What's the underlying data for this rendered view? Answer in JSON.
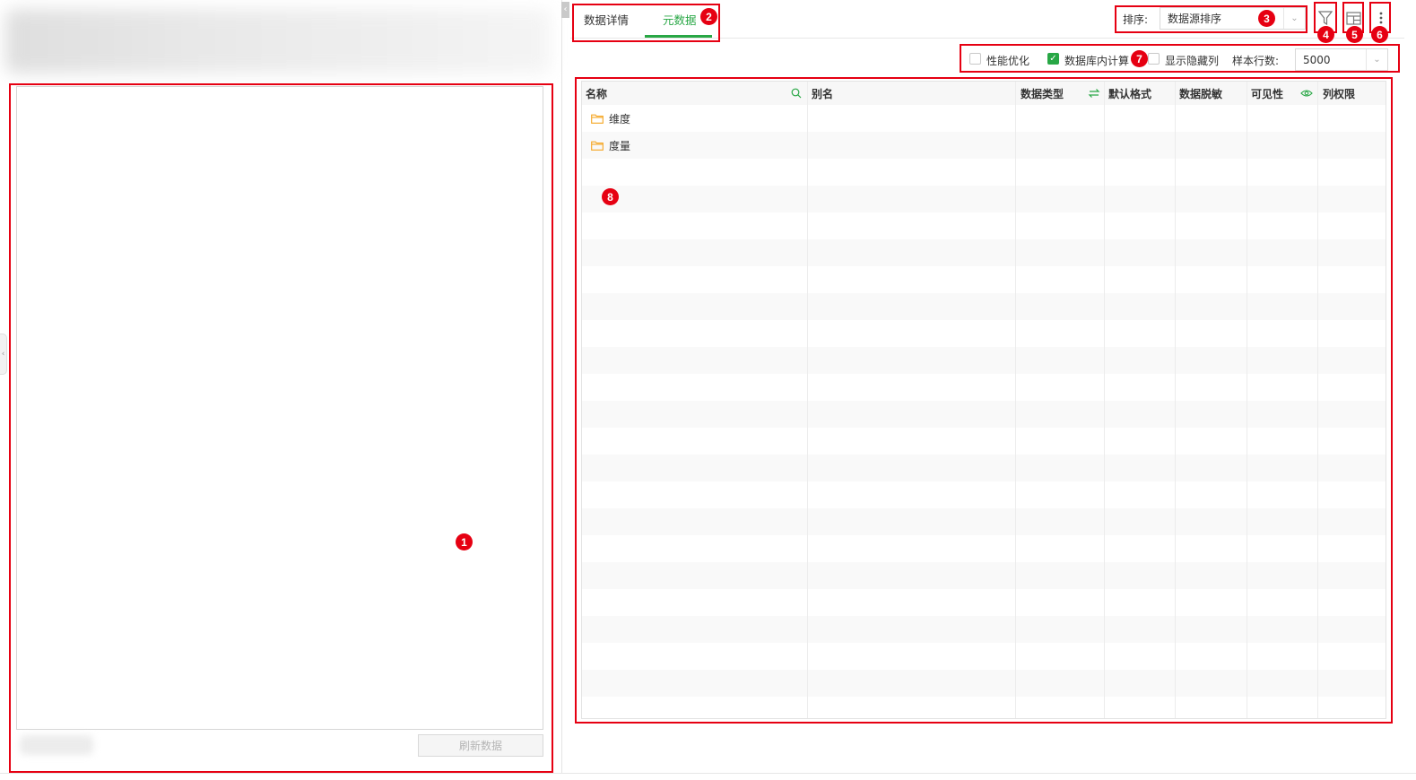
{
  "tabs": [
    {
      "label": "数据详情",
      "active": false
    },
    {
      "label": "元数据",
      "active": true
    }
  ],
  "sort": {
    "label": "排序:",
    "value": "数据源排序"
  },
  "options": {
    "performance": {
      "label": "性能优化",
      "checked": false
    },
    "db_compute": {
      "label": "数据库内计算",
      "checked": true
    },
    "show_hidden": {
      "label": "显示隐藏列",
      "checked": false
    },
    "sample_rows_label": "样本行数:",
    "sample_rows_value": "5000"
  },
  "table": {
    "headers": {
      "name": "名称",
      "alias": "别名",
      "data_type": "数据类型",
      "default_format": "默认格式",
      "masking": "数据脱敏",
      "visibility": "可见性",
      "column_permission": "列权限"
    },
    "rows": [
      {
        "name": "维度",
        "icon": "folder-icon"
      },
      {
        "name": "度量",
        "icon": "folder-icon"
      }
    ]
  },
  "left_panel": {
    "refresh_label": "刷新数据"
  },
  "annotations": [
    "1",
    "2",
    "3",
    "4",
    "5",
    "6",
    "7",
    "8"
  ],
  "colors": {
    "accent": "#28a745",
    "annotation": "#e60012",
    "folder": "#f5a623"
  }
}
